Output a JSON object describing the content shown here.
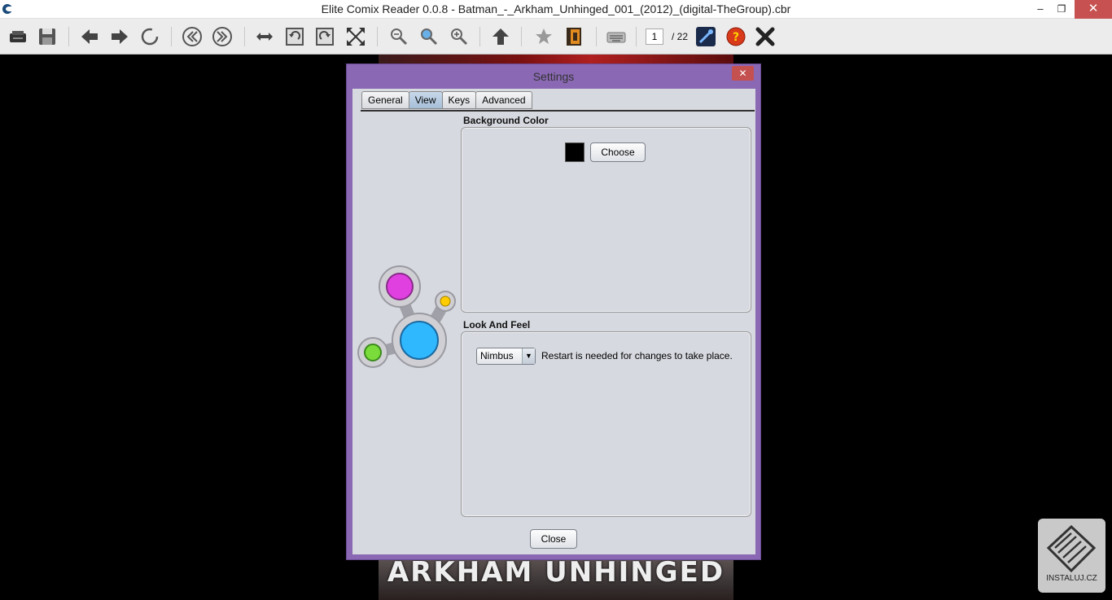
{
  "window": {
    "title": "Elite Comix Reader 0.0.8 - Batman_-_Arkham_Unhinged_001_(2012)_(digital-TheGroup).cbr",
    "minimize": "–",
    "maximize": "❐",
    "close": "✕"
  },
  "toolbar": {
    "current_page": "1",
    "total_pages": "/ 22",
    "icons": [
      "open-icon",
      "save-icon",
      "previous-icon",
      "next-icon",
      "refresh-icon",
      "first-page-icon",
      "last-page-icon",
      "fit-width-icon",
      "rotate-left-icon",
      "rotate-right-icon",
      "fullscreen-icon",
      "zoom-out-icon",
      "zoom-reset-icon",
      "zoom-in-icon",
      "up-icon",
      "bookmark-icon",
      "book-icon",
      "keyboard-icon",
      "settings-icon",
      "help-icon",
      "exit-icon"
    ]
  },
  "comic": {
    "cover_text": "ARKHAM UNHINGED"
  },
  "dialog": {
    "title": "Settings",
    "close_x": "✕",
    "tabs": [
      {
        "label": "General",
        "active": false
      },
      {
        "label": "View",
        "active": true
      },
      {
        "label": "Keys",
        "active": false
      },
      {
        "label": "Advanced",
        "active": false
      }
    ],
    "background_color": {
      "label": "Background Color",
      "swatch_color": "#000000",
      "choose_label": "Choose"
    },
    "look_and_feel": {
      "label": "Look And Feel",
      "selected": "Nimbus",
      "note": "Restart is needed for changes to take place."
    },
    "close_label": "Close"
  },
  "watermark": {
    "text": "INSTALUJ.CZ"
  }
}
